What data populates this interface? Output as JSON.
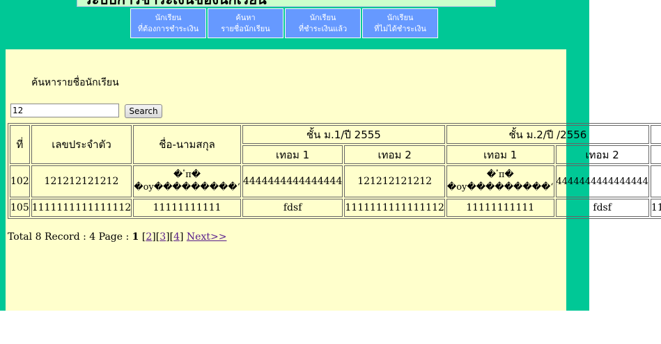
{
  "header": {
    "title": "ระบบการชำระเงินของนักเรียน"
  },
  "nav": [
    {
      "line1": "นักเรียน",
      "line2": "ที่ต้องการชำระเงิน"
    },
    {
      "line1": "ค้นหา",
      "line2": "รายชื่อนักเรียน"
    },
    {
      "line1": "นักเรียน",
      "line2": "ที่ชำระเงินแล้ว"
    },
    {
      "line1": "นักเรียน",
      "line2": "ที่ไม่ได้ชำระเงิน"
    }
  ],
  "page": {
    "heading": "ค้นหารายชื่อนักเรียน"
  },
  "search": {
    "value": "12",
    "button_label": "Search"
  },
  "table": {
    "headers": {
      "no": "ที่",
      "id": "เลขประจำตัว",
      "name": "ชื่อ-นามสกุล",
      "group1": "ชั้น ม.1/ปี 2555",
      "group2": "ชั้น ม.2/ปี /2556",
      "term1": "เทอม 1",
      "term2": "เทอม 2"
    },
    "rows": [
      {
        "no": "102",
        "id": "121212121212",
        "name_line1": "�ٴπ�",
        "name_line2": "�oy���������ʻ",
        "c1": "4444444444444444",
        "c2": "121212121212",
        "c3_line1": "�ٴπ�",
        "c3_line2": "�oy���������ʻ",
        "c4": "4444444444444444",
        "c5": ""
      },
      {
        "no": "105",
        "id": "1111111111111112",
        "name": "11111111111",
        "c1": "fdsf",
        "c2": "1111111111111112",
        "c3": "11111111111",
        "c4": "fdsf",
        "c5": "11"
      }
    ]
  },
  "pager": {
    "prefix": "Total 8 Record : 4 Page :",
    "current": "1",
    "pages": [
      "2",
      "3",
      "4"
    ],
    "next": "Next>>"
  }
}
